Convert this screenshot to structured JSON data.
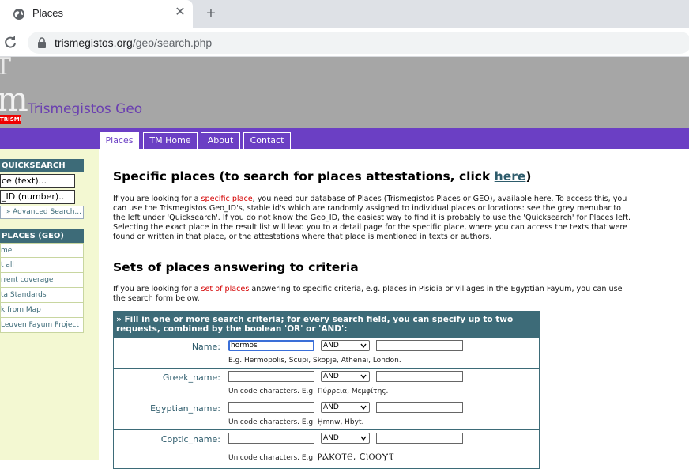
{
  "browser": {
    "tab_title": "Places",
    "url_host": "trismegistos.org",
    "url_path": "/geo/search.php"
  },
  "site": {
    "name": "Trismegistos Geo",
    "logo_letter": "m",
    "logo_top": "T",
    "logo_tag": "TRISMEGISTOS"
  },
  "nav": {
    "tabs": [
      {
        "label": "Places"
      },
      {
        "label": "TM Home"
      },
      {
        "label": "About"
      },
      {
        "label": "Contact"
      }
    ]
  },
  "sidebar": {
    "quicksearch_head": "QUICKSEARCH",
    "text_field": "ce (text)...",
    "id_field": "_ID (number)..",
    "advanced": "» Advanced Search...",
    "places_head": "PLACES (GEO)",
    "items": [
      {
        "label": "me"
      },
      {
        "label": "t all"
      },
      {
        "label": "rrent coverage"
      },
      {
        "label": "ta Standards"
      },
      {
        "label": "k from Map"
      },
      {
        "label": "Leuven Fayum Project"
      }
    ]
  },
  "main": {
    "heading1_pre": "Specific places (to search for places attestations, click ",
    "heading1_link": "here",
    "heading1_post": ")",
    "para1_pre": "If you are looking for a ",
    "para1_red": "specific place",
    "para1_post": ", you need our database of Places (Trismegistos Places or GEO), available here. To access this, you can use the Trismegistos Geo_ID's, stable id's which are randomly assigned to individual places or locations: see the grey menubar to the left under 'Quicksearch'. If you do not know the Geo_ID, the easiest way to find it is probably to use the 'Quicksearch' for Places left. Selecting the exact place in the result list will lead you to a detail page for the specific place, where you can access the texts that were found or written in that place, or the attestations where that place is mentioned in texts or authors.",
    "heading2": "Sets of places answering to criteria",
    "para2_pre": "If you are looking for a ",
    "para2_red": "set of places",
    "para2_post": " answering to specific criteria, e.g. places in Pisidia or villages in the Egyptian Fayum, you can use the search form below."
  },
  "form": {
    "header": "» Fill in one or more search criteria; for every search field, you can specify up to two requests, combined by the boolean 'OR' or 'AND':",
    "rows": [
      {
        "label": "Name:",
        "value": "hormos",
        "operator": "AND",
        "hint": "E.g. Hermopolis, Scupi, Skopje, Athenai, London."
      },
      {
        "label": "Greek_name:",
        "value": "",
        "operator": "AND",
        "hint": "Unicode characters. E.g. Πύρρεια, Μεμφίτης."
      },
      {
        "label": "Egyptian_name:",
        "value": "",
        "operator": "AND",
        "hint": "Unicode characters. E.g. Ḥmnw, Hbyt."
      },
      {
        "label": "Coptic_name:",
        "value": "",
        "operator": "AND",
        "hint": "Unicode characters. E.g.",
        "hint_coptic": "ⲢⲀⲔⲞⲦⲈ, ϹⲒⲞⲞⲨⲦ"
      }
    ]
  }
}
